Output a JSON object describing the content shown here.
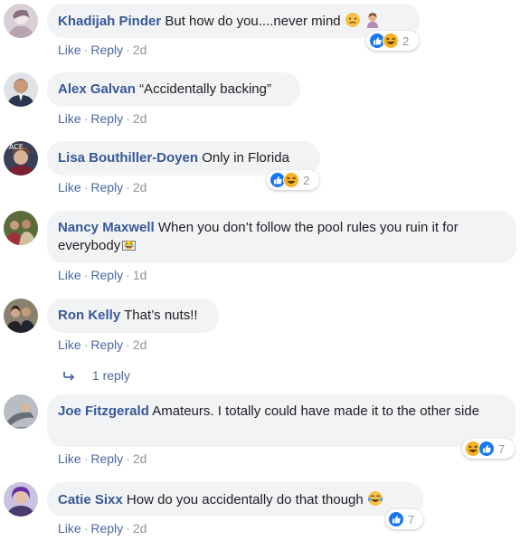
{
  "actions": {
    "like": "Like",
    "reply": "Reply",
    "sep": "·"
  },
  "comments": [
    {
      "author": "Khadijah Pinder",
      "text": "But how do you....never mind",
      "time": "2d",
      "reaction_count": "2",
      "reactions": [
        "like-icon",
        "haha-icon"
      ]
    },
    {
      "author": "Alex Galvan",
      "text": "“Accidentally backing”",
      "time": "2d"
    },
    {
      "author": "Lisa Bouthiller-Doyen",
      "text": "Only in Florida",
      "time": "2d",
      "reaction_count": "2",
      "reactions": [
        "like-icon",
        "haha-icon"
      ]
    },
    {
      "author": "Nancy Maxwell",
      "text": "When you don’t follow the pool rules you ruin it for everybody",
      "time": "1d"
    },
    {
      "author": "Ron Kelly",
      "text": "That’s nuts!!",
      "time": "2d",
      "replies_label": "1 reply"
    },
    {
      "author": "Joe Fitzgerald",
      "text": "Amateurs. I totally could have made it to the other side",
      "time": "2d",
      "reaction_count": "7",
      "reactions": [
        "haha-icon",
        "like-icon"
      ]
    },
    {
      "author": "Catie Sixx",
      "text": "How do you accidentally do that though",
      "time": "2d",
      "reaction_count": "7",
      "reactions": [
        "like-icon"
      ]
    }
  ],
  "colors": {
    "author": "#385898",
    "bubble": "#f2f3f5",
    "meta": "#90949c",
    "like_blue": "#1877f2",
    "haha_yellow": "#f7b125"
  },
  "avatar_overlay_text": "FACE",
  "broken_glyph": "😂"
}
